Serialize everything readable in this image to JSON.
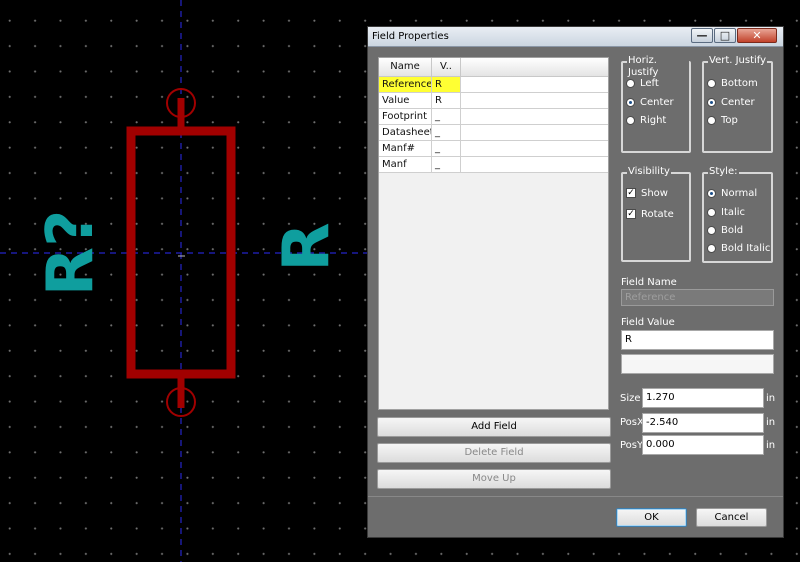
{
  "schematic": {
    "ref_text": "R?",
    "value_text": "R",
    "colors": {
      "body": "#a10000",
      "text": "#0f9e9e",
      "axis": "#2424c8",
      "grid": "#6f6f6f"
    }
  },
  "dialog": {
    "title": "Field Properties",
    "window_buttons": {
      "minimize": "—",
      "maximize": "□",
      "close": "✕"
    },
    "list": {
      "headers": [
        "Name",
        "V..",
        ""
      ],
      "rows": [
        {
          "name": "Reference",
          "value": "R"
        },
        {
          "name": "Value",
          "value": "R"
        },
        {
          "name": "Footprint",
          "value": "_"
        },
        {
          "name": "Datasheet",
          "value": "_"
        },
        {
          "name": "Manf#",
          "value": "_"
        },
        {
          "name": "Manf",
          "value": "_"
        }
      ]
    },
    "buttons": {
      "add_field": "Add Field",
      "delete_field": "Delete Field",
      "move_up": "Move Up",
      "ok": "OK",
      "cancel": "Cancel"
    },
    "horiz_justify": {
      "label": "Horiz. Justify",
      "options": [
        "Left",
        "Center",
        "Right"
      ],
      "selected": "Center"
    },
    "vert_justify": {
      "label": "Vert. Justify",
      "options": [
        "Bottom",
        "Center",
        "Top"
      ],
      "selected": "Center"
    },
    "visibility": {
      "label": "Visibility",
      "show": "Show",
      "rotate": "Rotate"
    },
    "style": {
      "label": "Style:",
      "options": [
        "Normal",
        "Italic",
        "Bold",
        "Bold Italic"
      ],
      "selected": "Normal"
    },
    "field_name": {
      "label": "Field Name",
      "value": "Reference"
    },
    "field_value": {
      "label": "Field Value",
      "value": "R"
    },
    "extra_value": "",
    "size": {
      "label": "Size",
      "value": "1.270",
      "unit": "in"
    },
    "posx": {
      "label": "PosX",
      "value": "-2.540",
      "unit": "in"
    },
    "posy": {
      "label": "PosY",
      "value": "0.000",
      "unit": "in"
    }
  }
}
